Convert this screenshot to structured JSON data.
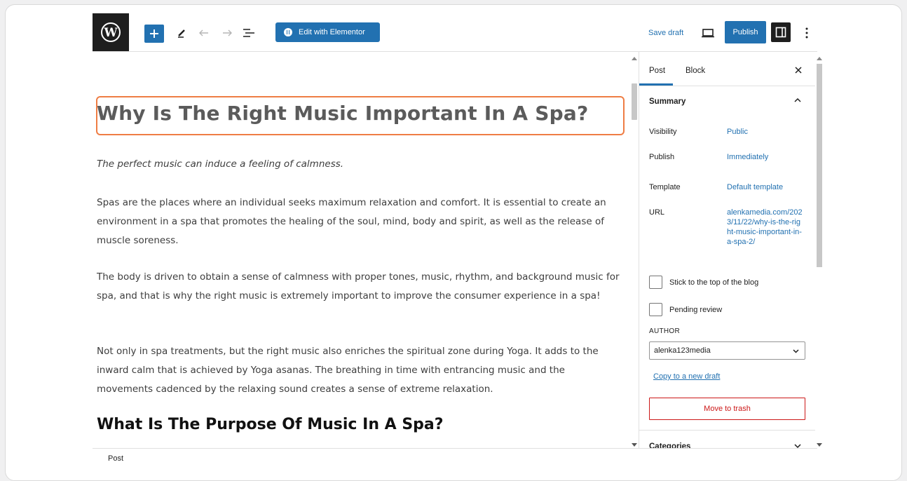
{
  "toolbar": {
    "elementor_label": "Edit with Elementor",
    "save_draft_label": "Save draft",
    "publish_label": "Publish"
  },
  "post": {
    "title": "Why Is The Right Music Important In A Spa?",
    "paragraphs": [
      "The perfect music can induce a feeling of calmness.",
      "Spas are the places where an individual seeks maximum relaxation and comfort. It is essential to create an environment in a spa that promotes the healing of the soul, mind, body and spirit, as well as the release of muscle soreness.",
      "The body is driven to obtain a sense of calmness with proper tones, music, rhythm, and background music for spa, and that is why the right music is extremely important to improve the consumer experience in a spa!",
      "Not only in spa treatments, but the right music also enriches the spiritual zone during Yoga. It adds to the inward calm that is achieved by Yoga asanas. The breathing in time with entrancing music and the movements cadenced by the relaxing sound creates a sense of extreme relaxation."
    ],
    "heading2": "What Is The Purpose Of Music In A Spa?"
  },
  "sidebar": {
    "tabs": [
      "Post",
      "Block"
    ],
    "summary_title": "Summary",
    "visibility_label": "Visibility",
    "visibility_value": "Public",
    "publish_label": "Publish",
    "publish_value": "Immediately",
    "template_label": "Template",
    "template_value": "Default template",
    "url_label": "URL",
    "url_value": "alenkamedia.com/2023/11/22/why-is-the-right-music-important-in-a-spa-2/",
    "sticky_label": "Stick to the top of the blog",
    "pending_label": "Pending review",
    "author_label": "AUTHOR",
    "author_value": "alenka123media",
    "copy_label": "Copy to a new draft",
    "trash_label": "Move to trash",
    "categories_label": "Categories"
  },
  "footer": {
    "breadcrumb": "Post"
  },
  "colors": {
    "accent": "#2271b1",
    "title_highlight": "#ef7d44",
    "danger": "#cc1818"
  }
}
